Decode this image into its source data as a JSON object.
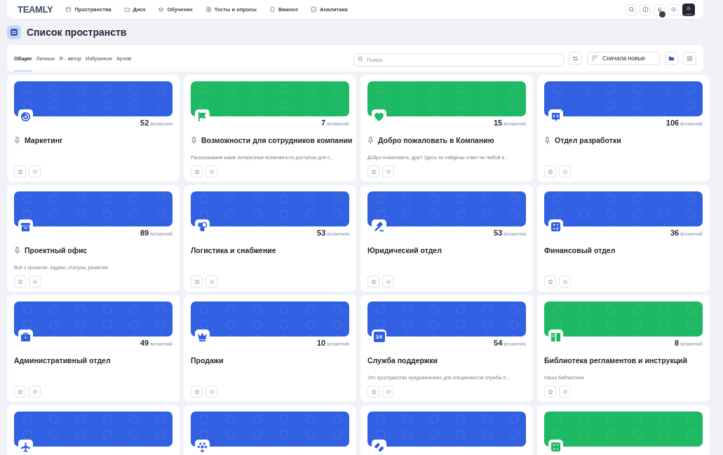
{
  "nav": {
    "logo": "TEAMLY",
    "items": [
      {
        "label": "Пространства"
      },
      {
        "label": "Диск"
      },
      {
        "label": "Обучение"
      },
      {
        "label": "Тесты и опросы"
      },
      {
        "label": "Важное"
      },
      {
        "label": "Аналитика"
      }
    ]
  },
  "page_title": "Список пространств",
  "tabs": [
    {
      "label": "Общие",
      "selected": true
    },
    {
      "label": "Личные",
      "selected": false
    },
    {
      "label": "Я - автор",
      "selected": false
    },
    {
      "label": "Избранное",
      "selected": false
    },
    {
      "label": "Архив",
      "selected": false
    }
  ],
  "search": {
    "placeholder": "Поиск"
  },
  "sort": {
    "value": "Сначала новые"
  },
  "cards": [
    {
      "title": "Маркетинг",
      "pinned": true,
      "count": "52",
      "count_label": "вложения",
      "color": "#3160e2"
    },
    {
      "title": "Возможности для сотрудников компании",
      "pinned": true,
      "count": "7",
      "count_label": "вложений",
      "color": "#1eb964",
      "description": "Рассказываем какие интересные возможности доступны для с..."
    },
    {
      "title": "Добро пожаловать в Компанию",
      "pinned": true,
      "count": "15",
      "count_label": "вложений",
      "color": "#1eb964",
      "description": "Добро пожаловать, друг! Здесь ты найдешь ответ на любой в..."
    },
    {
      "title": "Отдел разработки",
      "pinned": true,
      "count": "106",
      "count_label": "вложений",
      "color": "#3160e2"
    },
    {
      "title": "Проектный офис",
      "pinned": true,
      "count": "89",
      "count_label": "вложений",
      "color": "#3160e2",
      "description": "Всё о проектах: задачи, статусы, развитие"
    },
    {
      "title": "Логистика и снабжение",
      "pinned": false,
      "count": "53",
      "count_label": "вложения",
      "color": "#3160e2"
    },
    {
      "title": "Юридический отдел",
      "pinned": false,
      "count": "53",
      "count_label": "вложения",
      "color": "#3160e2"
    },
    {
      "title": "Финансовый отдел",
      "pinned": false,
      "count": "36",
      "count_label": "вложений",
      "color": "#3160e2"
    },
    {
      "title": "Административный отдел",
      "pinned": false,
      "count": "49",
      "count_label": "вложений",
      "color": "#3160e2"
    },
    {
      "title": "Продажи",
      "pinned": false,
      "count": "10",
      "count_label": "вложений",
      "color": "#3160e2"
    },
    {
      "title": "Служба поддержки",
      "pinned": false,
      "count": "54",
      "count_label": "вложения",
      "color": "#3160e2",
      "description": "Это пространство предназначено для специалистов службы п...",
      "icon_text": "24"
    },
    {
      "title": "Библиотека регламентов и инструкций",
      "pinned": false,
      "count": "8",
      "count_label": "вложений",
      "color": "#1eb964",
      "description": "Наша библиотека"
    },
    {
      "color": "#3160e2"
    },
    {
      "color": "#3160e2"
    },
    {
      "color": "#3160e2"
    },
    {
      "color": "#1eb964"
    }
  ]
}
